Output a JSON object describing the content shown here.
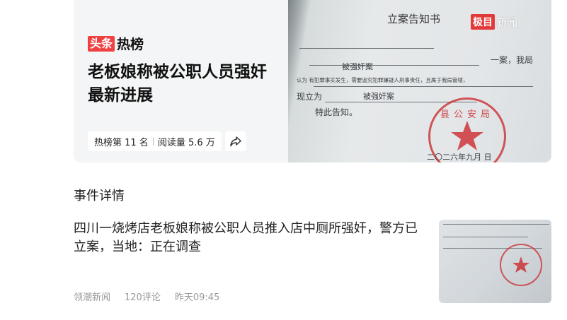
{
  "hero": {
    "brand_badge": "头条",
    "brand_text": "热榜",
    "title": "老板娘称被公职人员强奸最新进展",
    "rank": "热榜第 11 名",
    "reads": "阅读量 5.6 万",
    "share_icon": "share-icon"
  },
  "document_photo": {
    "heading": "立案告知书",
    "watermark_badge": "极目",
    "watermark_text": "新闻",
    "line1_end": "一案，我局",
    "line2_case": "被强奸案",
    "line3": "认为 有犯罪事实发生，需要追究犯罪嫌疑人刑事责任，且属于我局管辖，",
    "line4_prefix": "现立为",
    "line4_case": "被强奸案",
    "line5": "特此告知。",
    "stamp_text": "县公安局",
    "date_line": "二〇二六年九月",
    "date_suffix": "日"
  },
  "section": {
    "title": "事件详情"
  },
  "news_item": {
    "title": "四川一烧烤店老板娘称被公职人员推入店中厕所强奸，警方已立案，当地：正在调查",
    "source": "领潮新闻",
    "comments": "120评论",
    "time": "昨天09:45"
  },
  "colors": {
    "brand_red": "#f04142",
    "stamp_red": "#cb2a2e",
    "meta_gray": "#999999"
  }
}
